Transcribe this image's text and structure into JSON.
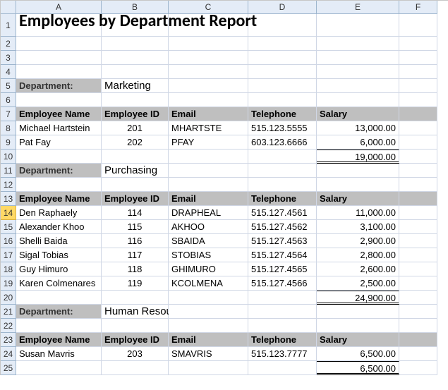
{
  "columns": [
    "A",
    "B",
    "C",
    "D",
    "E",
    "F"
  ],
  "rows": [
    "1",
    "2",
    "3",
    "4",
    "5",
    "6",
    "7",
    "8",
    "9",
    "10",
    "11",
    "12",
    "13",
    "14",
    "15",
    "16",
    "17",
    "18",
    "19",
    "20",
    "21",
    "22",
    "23",
    "24",
    "25"
  ],
  "title": "Employees by Department Report",
  "dept_label": "Department:",
  "headers": {
    "emp_name": "Employee Name",
    "emp_id": "Employee ID",
    "email": "Email",
    "telephone": "Telephone",
    "salary": "Salary"
  },
  "sections": [
    {
      "name": "Marketing",
      "rows": [
        {
          "name": "Michael Hartstein",
          "id": "201",
          "email": "MHARTSTE",
          "tel": "515.123.5555",
          "salary": "13,000.00"
        },
        {
          "name": "Pat Fay",
          "id": "202",
          "email": "PFAY",
          "tel": "603.123.6666",
          "salary": "6,000.00"
        }
      ],
      "total": "19,000.00"
    },
    {
      "name": "Purchasing",
      "rows": [
        {
          "name": "Den Raphaely",
          "id": "114",
          "email": "DRAPHEAL",
          "tel": "515.127.4561",
          "salary": "11,000.00"
        },
        {
          "name": "Alexander Khoo",
          "id": "115",
          "email": "AKHOO",
          "tel": "515.127.4562",
          "salary": "3,100.00"
        },
        {
          "name": "Shelli Baida",
          "id": "116",
          "email": "SBAIDA",
          "tel": "515.127.4563",
          "salary": "2,900.00"
        },
        {
          "name": "Sigal Tobias",
          "id": "117",
          "email": "STOBIAS",
          "tel": "515.127.4564",
          "salary": "2,800.00"
        },
        {
          "name": "Guy Himuro",
          "id": "118",
          "email": "GHIMURO",
          "tel": "515.127.4565",
          "salary": "2,600.00"
        },
        {
          "name": "Karen Colmenares",
          "id": "119",
          "email": "KCOLMENA",
          "tel": "515.127.4566",
          "salary": "2,500.00"
        }
      ],
      "total": "24,900.00"
    },
    {
      "name": "Human Resources",
      "rows": [
        {
          "name": "Susan Mavris",
          "id": "203",
          "email": "SMAVRIS",
          "tel": "515.123.7777",
          "salary": "6,500.00"
        }
      ],
      "total": "6,500.00"
    }
  ],
  "chart_data": {
    "type": "table",
    "title": "Employees by Department Report",
    "groups": [
      {
        "department": "Marketing",
        "total_salary": 19000,
        "employees": [
          {
            "name": "Michael Hartstein",
            "id": 201,
            "email": "MHARTSTE",
            "tel": "515.123.5555",
            "salary": 13000
          },
          {
            "name": "Pat Fay",
            "id": 202,
            "email": "PFAY",
            "tel": "603.123.6666",
            "salary": 6000
          }
        ]
      },
      {
        "department": "Purchasing",
        "total_salary": 24900,
        "employees": [
          {
            "name": "Den Raphaely",
            "id": 114,
            "email": "DRAPHEAL",
            "tel": "515.127.4561",
            "salary": 11000
          },
          {
            "name": "Alexander Khoo",
            "id": 115,
            "email": "AKHOO",
            "tel": "515.127.4562",
            "salary": 3100
          },
          {
            "name": "Shelli Baida",
            "id": 116,
            "email": "SBAIDA",
            "tel": "515.127.4563",
            "salary": 2900
          },
          {
            "name": "Sigal Tobias",
            "id": 117,
            "email": "STOBIAS",
            "tel": "515.127.4564",
            "salary": 2800
          },
          {
            "name": "Guy Himuro",
            "id": 118,
            "email": "GHIMURO",
            "tel": "515.127.4565",
            "salary": 2600
          },
          {
            "name": "Karen Colmenares",
            "id": 119,
            "email": "KCOLMENA",
            "tel": "515.127.4566",
            "salary": 2500
          }
        ]
      },
      {
        "department": "Human Resources",
        "total_salary": 6500,
        "employees": [
          {
            "name": "Susan Mavris",
            "id": 203,
            "email": "SMAVRIS",
            "tel": "515.123.7777",
            "salary": 6500
          }
        ]
      }
    ]
  }
}
